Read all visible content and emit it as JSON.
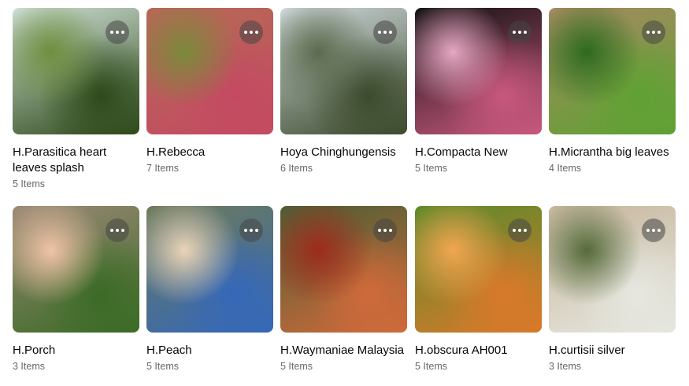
{
  "albums": [
    {
      "title": "H.Parasitica heart leaves splash",
      "count": "5 Items",
      "colors": [
        "#cfe0d6",
        "#6f8f3e",
        "#2e4a1a"
      ],
      "thumb_icon": "more-options-icon"
    },
    {
      "title": "H.Rebecca",
      "count": "7 Items",
      "colors": [
        "#b56a55",
        "#7a8a3a",
        "#c44a62"
      ],
      "thumb_icon": "more-options-icon"
    },
    {
      "title": "Hoya Chinghungensis",
      "count": "6 Items",
      "colors": [
        "#cfd8da",
        "#5c6b4e",
        "#3c4a2c"
      ],
      "thumb_icon": "more-options-icon"
    },
    {
      "title": "H.Compacta New",
      "count": "5 Items",
      "colors": [
        "#111111",
        "#e6a7c3",
        "#c8587e"
      ],
      "thumb_icon": "more-options-icon"
    },
    {
      "title": "H.Micrantha big leaves",
      "count": "4 Items",
      "colors": [
        "#a58a60",
        "#2c6b1f",
        "#5fa133"
      ],
      "thumb_icon": "more-options-icon"
    },
    {
      "title": "H.Porch",
      "count": "3 Items",
      "colors": [
        "#9a8875",
        "#f0c3a6",
        "#3b6b26"
      ],
      "thumb_icon": "more-options-icon"
    },
    {
      "title": "H.Peach",
      "count": "5 Items",
      "colors": [
        "#6c7a5a",
        "#e9d4b8",
        "#3568b8"
      ],
      "thumb_icon": "more-options-icon"
    },
    {
      "title": "H.Waymaniae Malaysia",
      "count": "5 Items",
      "colors": [
        "#4c5e35",
        "#9e2b1c",
        "#d06a3a"
      ],
      "thumb_icon": "more-options-icon"
    },
    {
      "title": "H.obscura AH001",
      "count": "5 Items",
      "colors": [
        "#5a8a2a",
        "#f2a650",
        "#d9792a"
      ],
      "thumb_icon": "more-options-icon"
    },
    {
      "title": "H.curtisii silver",
      "count": "3 Items",
      "colors": [
        "#c6b69c",
        "#556b3b",
        "#e6e7e0"
      ],
      "thumb_icon": "more-options-icon"
    }
  ]
}
